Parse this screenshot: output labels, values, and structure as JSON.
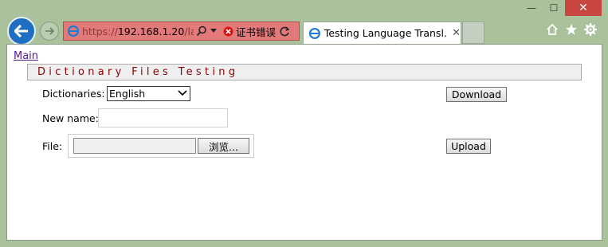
{
  "window": {
    "minimize": "—",
    "maximize": "☐",
    "close": "✕"
  },
  "address": {
    "scheme": "https://",
    "host": "192.168.1.20",
    "path": "/lang",
    "cert_error": "证书错误"
  },
  "tab": {
    "title": "Testing Language Transl..."
  },
  "page": {
    "main_link": "Main",
    "header": "Dictionary Files Testing",
    "dictionaries_label": "Dictionaries:",
    "dictionaries_selected": "English",
    "download_label": "Download",
    "new_name_label": "New name:",
    "new_name_value": "",
    "file_label": "File:",
    "browse_label": "浏览...",
    "upload_label": "Upload"
  },
  "colors": {
    "accent": "#1e6fc1",
    "cert_error_bg": "#e27a7a",
    "header_text": "#8b0000"
  }
}
